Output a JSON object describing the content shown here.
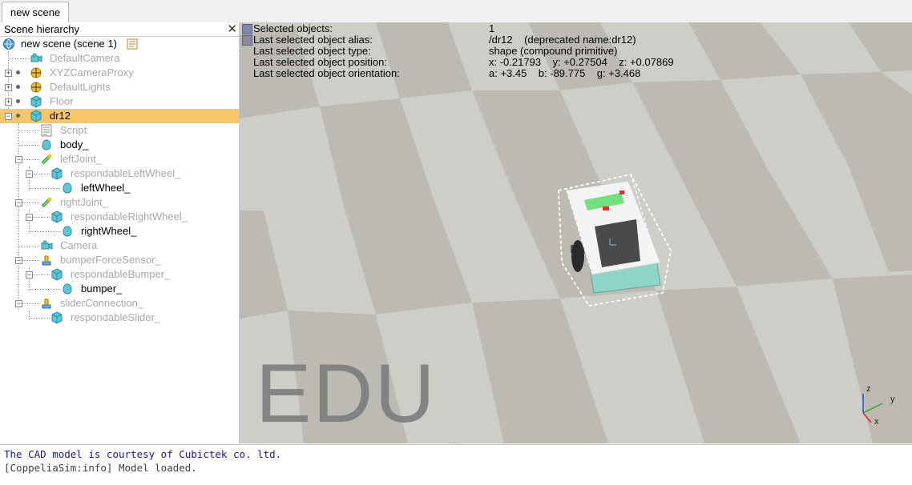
{
  "tabs": [
    {
      "label": "new scene"
    }
  ],
  "hierarchy": {
    "title": "Scene hierarchy",
    "close_glyph": "✕",
    "items": [
      {
        "label": "new scene (scene 1)",
        "icon": "world-icon"
      },
      {
        "label": "DefaultCamera",
        "icon": "camera-icon"
      },
      {
        "label": "XYZCameraProxy",
        "icon": "dummy-icon"
      },
      {
        "label": "DefaultLights",
        "icon": "light-icon"
      },
      {
        "label": "Floor",
        "icon": "shape-icon"
      },
      {
        "label": "dr12",
        "icon": "shape-icon"
      },
      {
        "label": "Script",
        "icon": "script-icon"
      },
      {
        "label": "body_",
        "icon": "shape-icon"
      },
      {
        "label": "leftJoint_",
        "icon": "joint-icon"
      },
      {
        "label": "respondableLeftWheel_",
        "icon": "shape-icon"
      },
      {
        "label": "leftWheel_",
        "icon": "shape-icon"
      },
      {
        "label": "rightJoint_",
        "icon": "joint-icon"
      },
      {
        "label": "respondableRightWheel_",
        "icon": "shape-icon"
      },
      {
        "label": "rightWheel_",
        "icon": "shape-icon"
      },
      {
        "label": "Camera",
        "icon": "camera-icon"
      },
      {
        "label": "bumperForceSensor_",
        "icon": "force-sensor-icon"
      },
      {
        "label": "respondableBumper_",
        "icon": "shape-icon"
      },
      {
        "label": "bumper_",
        "icon": "shape-icon"
      },
      {
        "label": "sliderConnection_",
        "icon": "force-sensor-icon"
      },
      {
        "label": "respondableSlider_",
        "icon": "shape-icon"
      }
    ]
  },
  "info": [
    {
      "label": "Selected objects:",
      "value": "1"
    },
    {
      "label": "Last selected object alias:",
      "value": "/dr12    (deprecated name:dr12)"
    },
    {
      "label": "Last selected object type:",
      "value": "shape (compound primitive)"
    },
    {
      "label": "Last selected object position:",
      "value": "x: -0.21793    y: +0.27504    z: +0.07869"
    },
    {
      "label": "Last selected object orientation:",
      "value": "a: +3.45    b: -89.775    g: +3.468"
    }
  ],
  "watermark": "EDU",
  "axes": {
    "x": "x",
    "y": "y",
    "z": "z"
  },
  "console": [
    {
      "text": "The CAD model is courtesy of Cubictek co. ltd.",
      "color": "#1a1a8c"
    },
    {
      "text": "[CoppeliaSim:info] Model loaded.",
      "color": "#404040"
    }
  ],
  "colors": {
    "selected_row": "#f6c66a",
    "dim_text": "#a8a8a8",
    "shape_icon": "#5fc6d6"
  }
}
